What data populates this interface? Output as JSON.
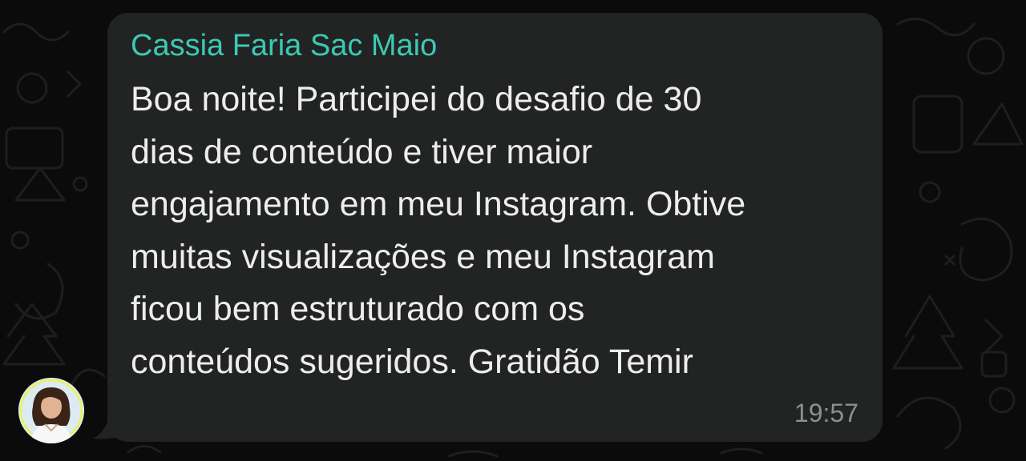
{
  "chat": {
    "message": {
      "sender": "Cassia Faria Sac Maio",
      "lines": [
        "Boa noite! Participei do desafio de 30",
        "dias de conteúdo e tiver maior",
        "engajamento em meu Instagram. Obtive",
        "muitas visualizações e meu Instagram",
        "ficou bem estruturado com os",
        "conteúdos sugeridos. Gratidão Temir"
      ],
      "time": "19:57"
    }
  },
  "colors": {
    "background": "#0b0b0b",
    "bubble": "#222323",
    "sender_name": "#3cc9b4",
    "message_text": "#ededed",
    "timestamp": "#8d8f90"
  },
  "icons": {
    "avatar": "sender-avatar-photo"
  }
}
